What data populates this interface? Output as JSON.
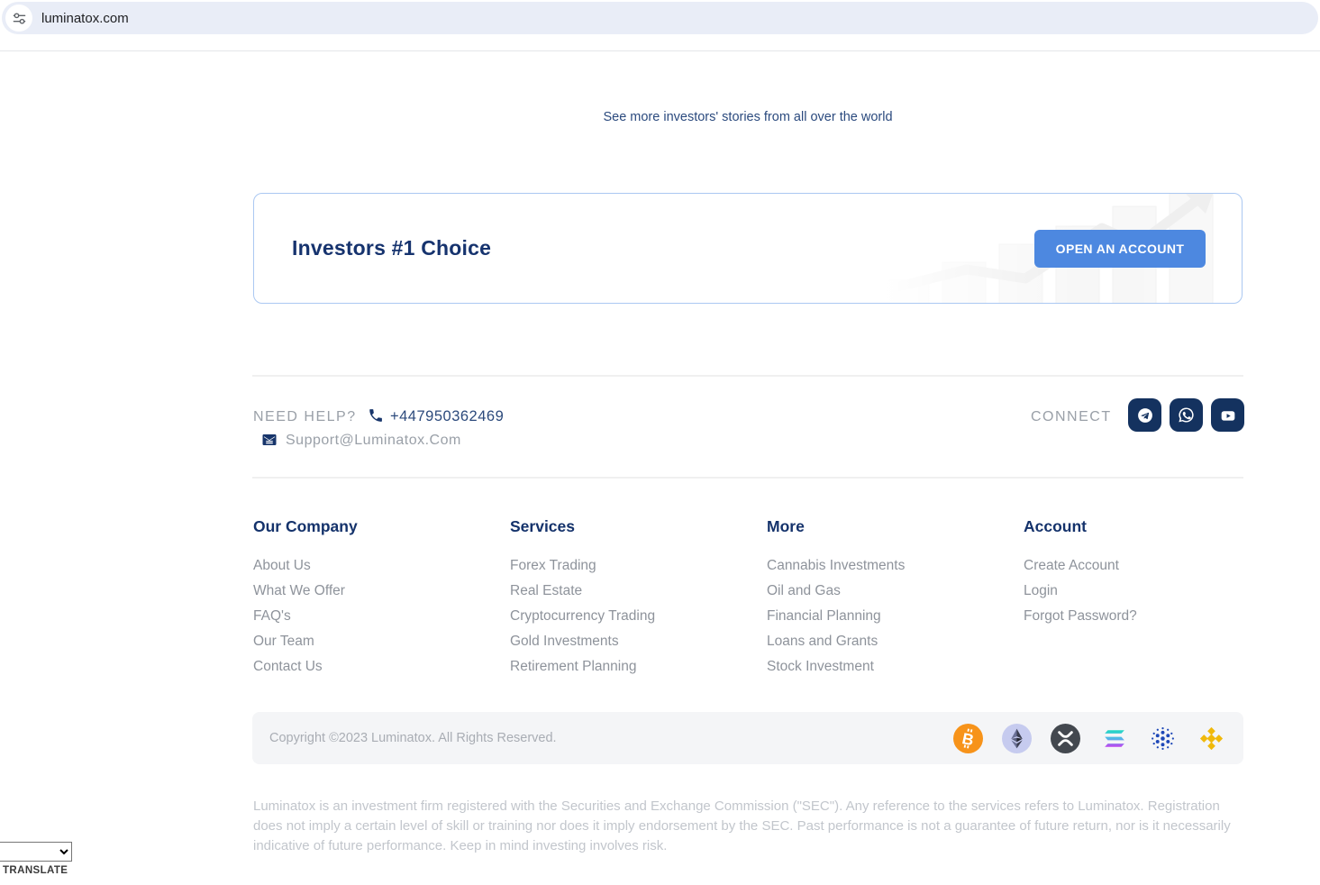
{
  "browser": {
    "url": "luminatox.com"
  },
  "hero": {
    "stories_text": "See more investors' stories from all over the world",
    "banner_title": "Investors #1 Choice",
    "cta_label": "OPEN AN ACCOUNT"
  },
  "support": {
    "need_help_label": "NEED HELP?",
    "phone": "+447950362469",
    "email": "Support@Luminatox.Com",
    "connect_label": "CONNECT",
    "social_icons": [
      "telegram",
      "whatsapp",
      "youtube"
    ]
  },
  "footer": {
    "columns": [
      {
        "title": "Our Company",
        "links": [
          "About Us",
          "What We Offer",
          "FAQ's",
          "Our Team",
          "Contact Us"
        ]
      },
      {
        "title": "Services",
        "links": [
          "Forex Trading",
          "Real Estate",
          "Cryptocurrency Trading",
          "Gold Investments",
          "Retirement Planning"
        ]
      },
      {
        "title": "More",
        "links": [
          "Cannabis Investments",
          "Oil and Gas",
          "Financial Planning",
          "Loans and Grants",
          "Stock Investment"
        ]
      },
      {
        "title": "Account",
        "links": [
          "Create Account",
          "Login",
          "Forgot Password?"
        ]
      }
    ],
    "copyright": "Copyright ©2023 Luminatox. All Rights Reserved.",
    "crypto_icons": [
      "bitcoin",
      "ethereum",
      "xrp",
      "solana",
      "cardano",
      "binance"
    ],
    "disclaimer": "Luminatox is an investment firm registered with the Securities and Exchange Commission (\"SEC\"). Any reference to the services refers to Luminatox. Registration does not imply a certain level of skill or training nor does it imply endorsement by the SEC. Past performance is not a guarantee of future return, nor is it necessarily indicative of future performance. Keep in mind investing involves risk."
  },
  "translate": {
    "label": "TRANSLATE"
  },
  "colors": {
    "navy_heading": "#14326b",
    "accent_blue": "#4d88e0",
    "icon_navy": "#14325f",
    "link_gray": "#8e939b",
    "bitcoin_orange": "#f7931a",
    "binance_gold": "#f0b90b",
    "cardano_blue": "#1e48b8",
    "xrp_dark": "#43484f",
    "omnibox_bg": "#e9edf7"
  }
}
